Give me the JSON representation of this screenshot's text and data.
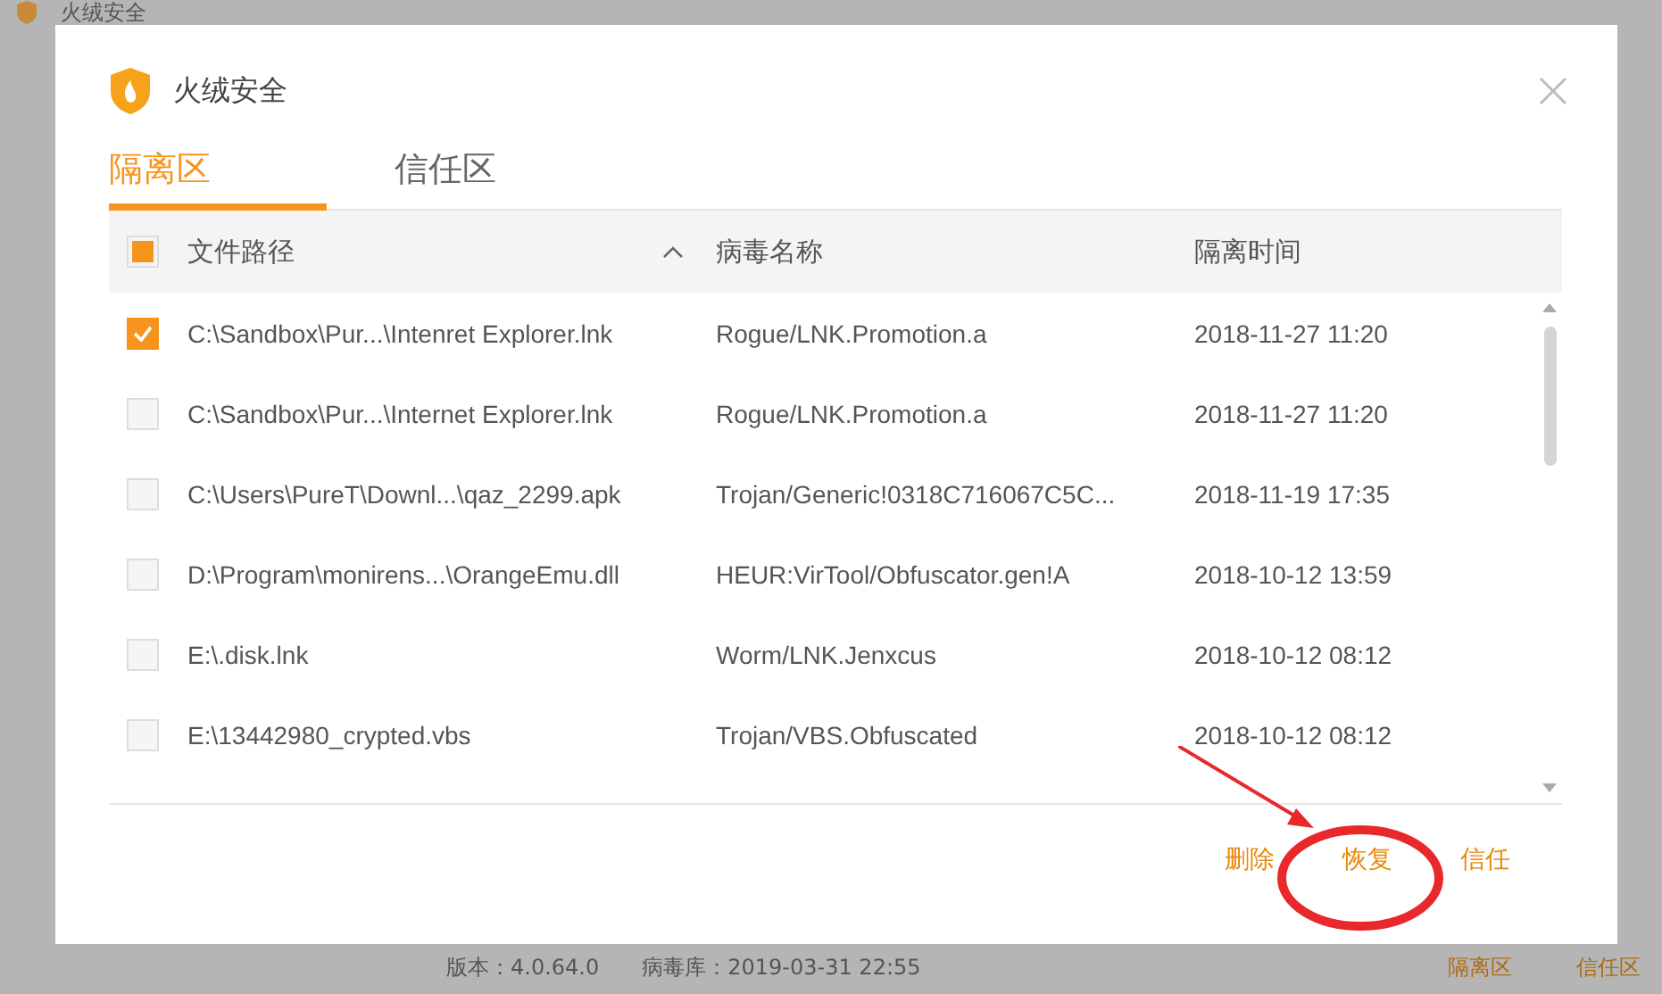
{
  "background_app": {
    "title": "火绒安全",
    "version": "版本：4.0.64.0",
    "virus_db": "病毒库：2019-03-31 22:55",
    "links": [
      "隔离区",
      "信任区"
    ]
  },
  "dialog": {
    "title": "火绒安全",
    "tabs": [
      {
        "label": "隔离区",
        "selected": true
      },
      {
        "label": "信任区",
        "selected": false
      }
    ],
    "table": {
      "select_all": {
        "partial": true
      },
      "columns": [
        "文件路径",
        "病毒名称",
        "隔离时间"
      ],
      "rows": [
        {
          "checked": true,
          "path": "C:\\Sandbox\\Pur...\\Intenret Explorer.lnk",
          "virus": "Rogue/LNK.Promotion.a",
          "time": "2018-11-27 11:20"
        },
        {
          "checked": false,
          "path": "C:\\Sandbox\\Pur...\\Internet Explorer.lnk",
          "virus": "Rogue/LNK.Promotion.a",
          "time": "2018-11-27 11:20"
        },
        {
          "checked": false,
          "path": "C:\\Users\\PureT\\Downl...\\qaz_2299.apk",
          "virus": "Trojan/Generic!0318C716067C5C...",
          "time": "2018-11-19 17:35"
        },
        {
          "checked": false,
          "path": "D:\\Program\\monirens...\\OrangeEmu.dll",
          "virus": "HEUR:VirTool/Obfuscator.gen!A",
          "time": "2018-10-12 13:59"
        },
        {
          "checked": false,
          "path": "E:\\.disk.lnk",
          "virus": "Worm/LNK.Jenxcus",
          "time": "2018-10-12 08:12"
        },
        {
          "checked": false,
          "path": "E:\\13442980_crypted.vbs",
          "virus": "Trojan/VBS.Obfuscated",
          "time": "2018-10-12 08:12"
        }
      ]
    },
    "buttons": [
      "删除",
      "恢复",
      "信任"
    ]
  }
}
